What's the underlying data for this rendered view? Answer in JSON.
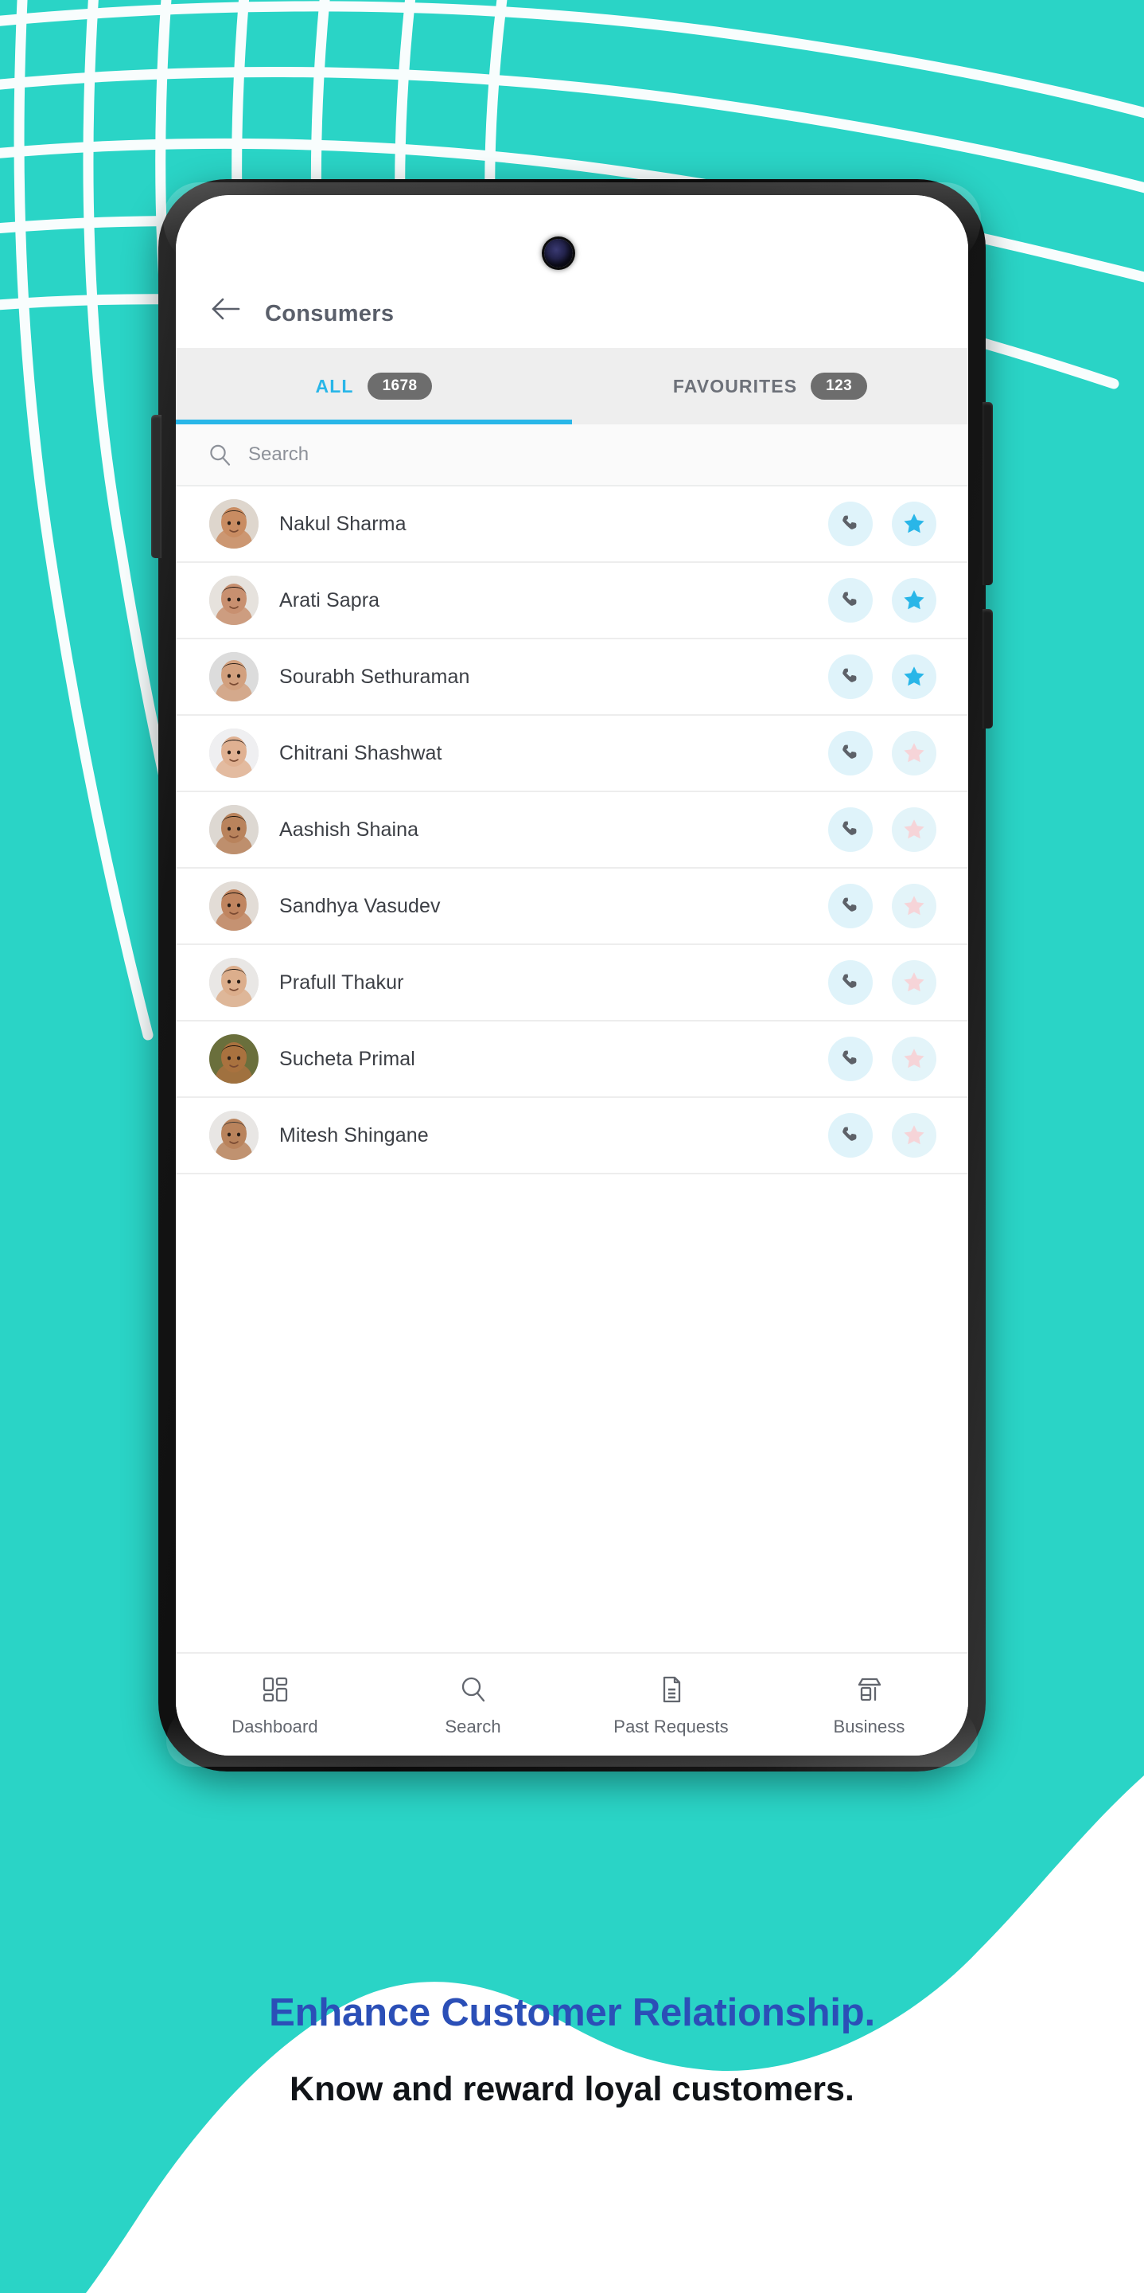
{
  "background": {
    "teal": "#2ad4c6",
    "white": "#ffffff",
    "grid_line_color": "#ffffff"
  },
  "phone": {
    "frame_color": "#111111",
    "camera": "front-camera-punch-hole"
  },
  "app": {
    "header": {
      "back_icon": "arrow-left-icon",
      "title": "Consumers"
    },
    "tabs": [
      {
        "label": "ALL",
        "badge": "1678",
        "active": true
      },
      {
        "label": "FAVOURITES",
        "badge": "123",
        "active": false
      }
    ],
    "tab_accent_color": "#29b6e8",
    "search": {
      "icon": "search-icon",
      "placeholder": "Search",
      "value": ""
    },
    "contacts": [
      {
        "name": "Nakul Sharma",
        "favourite": true
      },
      {
        "name": "Arati Sapra",
        "favourite": true
      },
      {
        "name": "Sourabh Sethuraman",
        "favourite": true
      },
      {
        "name": "Chitrani Shashwat",
        "favourite": false
      },
      {
        "name": "Aashish Shaina",
        "favourite": false
      },
      {
        "name": "Sandhya Vasudev",
        "favourite": false
      },
      {
        "name": "Prafull Thakur",
        "favourite": false
      },
      {
        "name": "Sucheta Primal",
        "favourite": false
      },
      {
        "name": "Mitesh Shingane",
        "favourite": false
      }
    ],
    "row_actions": {
      "call_icon": "phone-icon",
      "favourite_icon": "star-icon",
      "star_on_color": "#29b6e8",
      "star_off_color": "#f6d4d8"
    },
    "bottom_nav": [
      {
        "label": "Dashboard",
        "icon": "dashboard-grid-icon"
      },
      {
        "label": "Search",
        "icon": "search-icon"
      },
      {
        "label": "Past Requests",
        "icon": "document-icon"
      },
      {
        "label": "Business",
        "icon": "store-icon"
      }
    ]
  },
  "promo": {
    "headline": "Enhance Customer Relationship.",
    "subtext": "Know and reward loyal customers.",
    "headline_color": "#2b4fb7",
    "subtext_color": "#111418"
  }
}
